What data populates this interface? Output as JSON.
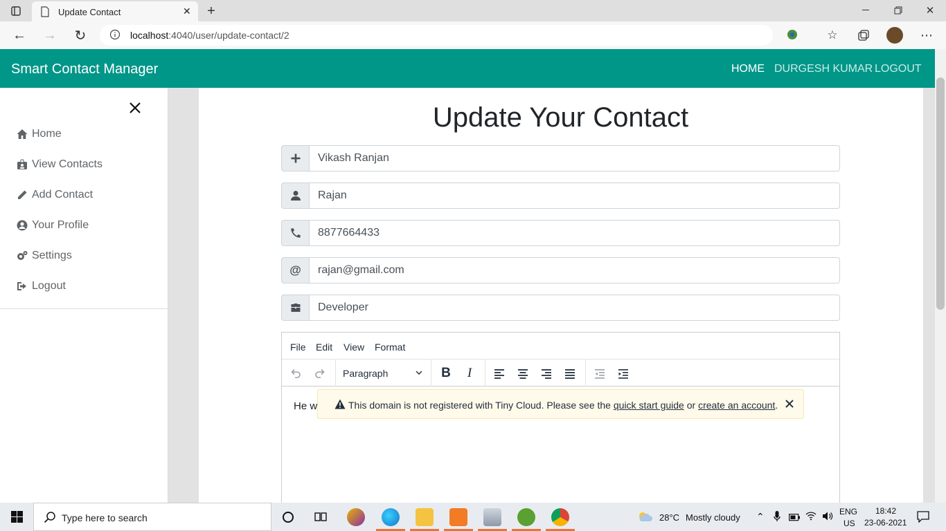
{
  "browser": {
    "tab_title": "Update Contact",
    "url_host": "localhost",
    "url_rest": ":4040/user/update-contact/2"
  },
  "navbar": {
    "brand": "Smart Contact Manager",
    "links": [
      "HOME",
      "DURGESH KUMAR",
      "LOGOUT"
    ]
  },
  "sidebar": {
    "items": [
      {
        "label": "Home",
        "icon": "home-icon"
      },
      {
        "label": "View Contacts",
        "icon": "id-badge-icon"
      },
      {
        "label": "Add Contact",
        "icon": "pencil-icon"
      },
      {
        "label": "Your Profile",
        "icon": "user-circle-icon"
      },
      {
        "label": "Settings",
        "icon": "cogs-icon"
      },
      {
        "label": "Logout",
        "icon": "sign-out-icon"
      }
    ]
  },
  "form": {
    "title": "Update Your Contact",
    "fields": [
      {
        "icon": "plus-icon",
        "value": "Vikash Ranjan"
      },
      {
        "icon": "user-icon",
        "value": "Rajan"
      },
      {
        "icon": "phone-icon",
        "value": "8877664433"
      },
      {
        "icon": "at-icon",
        "value": "rajan@gmail.com"
      },
      {
        "icon": "briefcase-icon",
        "value": "Developer"
      }
    ]
  },
  "editor": {
    "menu": [
      "File",
      "Edit",
      "View",
      "Format"
    ],
    "block_format": "Paragraph",
    "content_visible": "He w",
    "notice": {
      "text_before": "This domain is not registered with Tiny Cloud. Please see the",
      "link1": "quick start guide",
      "middle": "or",
      "link2": "create an account",
      "end": "."
    }
  },
  "taskbar": {
    "search_placeholder": "Type here to search",
    "weather_temp": "28°C",
    "weather_desc": "Mostly cloudy",
    "lang": "ENG",
    "region": "US",
    "time": "18:42",
    "date": "23-06-2021"
  },
  "colors": {
    "navbar": "#009688",
    "accent_underline": "#e8743c"
  }
}
